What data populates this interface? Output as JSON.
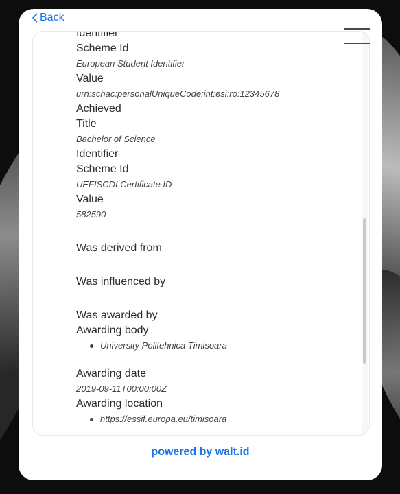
{
  "nav": {
    "back_label": "Back"
  },
  "credential": {
    "cut_label": "Identifier",
    "scheme_id_label": "Scheme Id",
    "scheme_id_value": "European Student Identifier",
    "value_label": "Value",
    "value_value": "urn:schac:personalUniqueCode:int:esi:ro:12345678",
    "achieved_label": "Achieved",
    "title_label": "Title",
    "title_value": "Bachelor of Science",
    "identifier_label": "Identifier",
    "scheme_id_label_2": "Scheme Id",
    "scheme_id_value_2": "UEFISCDI Certificate ID",
    "value_label_2": "Value",
    "value_value_2": "582590",
    "derived_label": "Was derived from",
    "influenced_label": "Was influenced by",
    "awarded_label": "Was awarded by",
    "awarding_body_label": "Awarding body",
    "awarding_body_items": [
      "University Politehnica Timisoara"
    ],
    "awarding_date_label": "Awarding date",
    "awarding_date_value": "2019-09-11T00:00:00Z",
    "awarding_location_label": "Awarding location",
    "awarding_location_items": [
      "https://essif.europa.eu/timisoara"
    ]
  },
  "footer": {
    "powered_by": "powered by walt.id"
  },
  "colors": {
    "accent": "#1a73e8",
    "background": "#0d0d0d"
  }
}
